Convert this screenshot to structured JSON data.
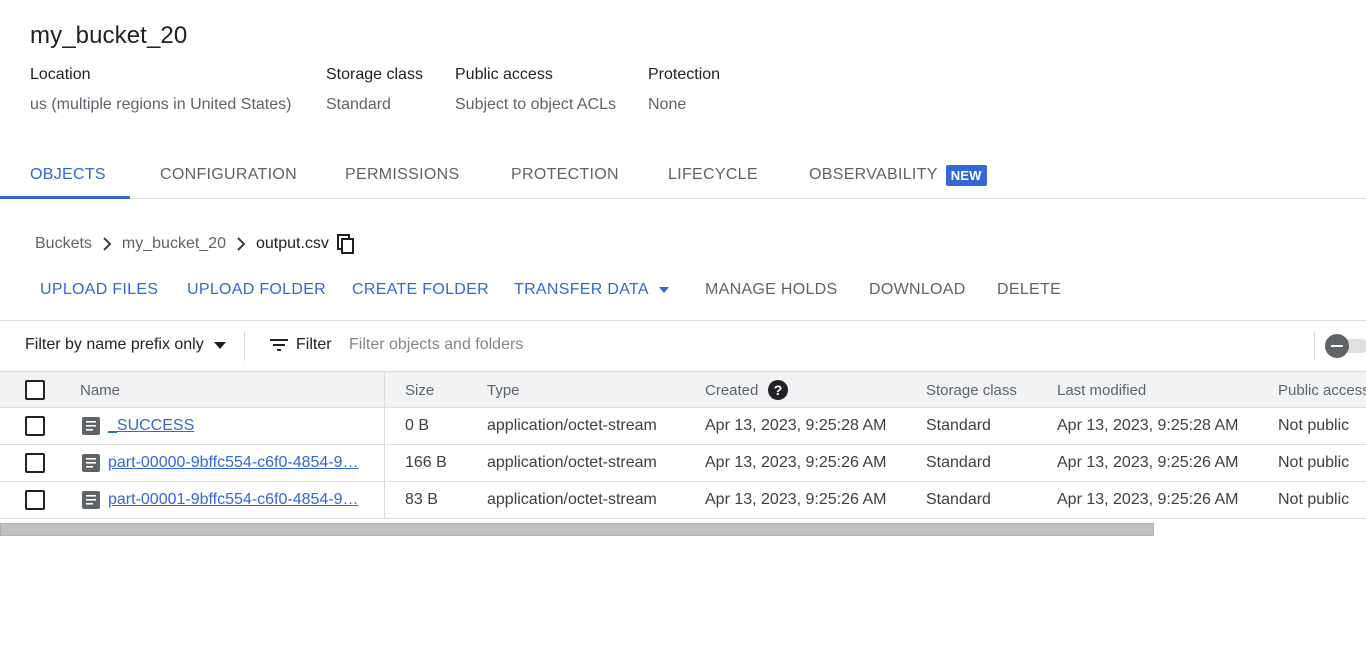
{
  "bucket": {
    "title": "my_bucket_20",
    "meta": [
      {
        "label": "Location",
        "value": "us (multiple regions in United States)"
      },
      {
        "label": "Storage class",
        "value": "Standard"
      },
      {
        "label": "Public access",
        "value": "Subject to object ACLs"
      },
      {
        "label": "Protection",
        "value": "None"
      }
    ]
  },
  "tabs": [
    {
      "label": "OBJECTS",
      "active": true
    },
    {
      "label": "CONFIGURATION"
    },
    {
      "label": "PERMISSIONS"
    },
    {
      "label": "PROTECTION"
    },
    {
      "label": "LIFECYCLE"
    },
    {
      "label": "OBSERVABILITY",
      "badge": "NEW"
    }
  ],
  "breadcrumb": {
    "items": [
      "Buckets",
      "my_bucket_20",
      "output.csv"
    ]
  },
  "actions": {
    "upload_files": "UPLOAD FILES",
    "upload_folder": "UPLOAD FOLDER",
    "create_folder": "CREATE FOLDER",
    "transfer_data": "TRANSFER DATA",
    "manage_holds": "MANAGE HOLDS",
    "download": "DOWNLOAD",
    "delete": "DELETE"
  },
  "filter": {
    "prefix_label": "Filter by name prefix only",
    "filter_label": "Filter",
    "placeholder": "Filter objects and folders"
  },
  "table": {
    "columns": {
      "name": "Name",
      "size": "Size",
      "type": "Type",
      "created": "Created",
      "storage_class": "Storage class",
      "last_modified": "Last modified",
      "public_access": "Public access"
    },
    "rows": [
      {
        "name": "_SUCCESS",
        "size": "0 B",
        "type": "application/octet-stream",
        "created": "Apr 13, 2023, 9:25:28 AM",
        "storage_class": "Standard",
        "last_modified": "Apr 13, 2023, 9:25:28 AM",
        "public_access": "Not public"
      },
      {
        "name": "part-00000-9bffc554-c6f0-4854-9…",
        "size": "166 B",
        "type": "application/octet-stream",
        "created": "Apr 13, 2023, 9:25:26 AM",
        "storage_class": "Standard",
        "last_modified": "Apr 13, 2023, 9:25:26 AM",
        "public_access": "Not public"
      },
      {
        "name": "part-00001-9bffc554-c6f0-4854-9…",
        "size": "83 B",
        "type": "application/octet-stream",
        "created": "Apr 13, 2023, 9:25:26 AM",
        "storage_class": "Standard",
        "last_modified": "Apr 13, 2023, 9:25:26 AM",
        "public_access": "Not public"
      }
    ]
  },
  "icons": {
    "copy": "copy-icon",
    "chevron": "chevron-right-icon",
    "caret": "caret-down-icon",
    "filter": "filter-icon",
    "file": "file-icon",
    "help": "help-icon",
    "density": "density-toggle-icon"
  },
  "colors": {
    "accent": "#3367d6",
    "header_bg": "#f1f3f4",
    "muted": "#5f6368"
  }
}
